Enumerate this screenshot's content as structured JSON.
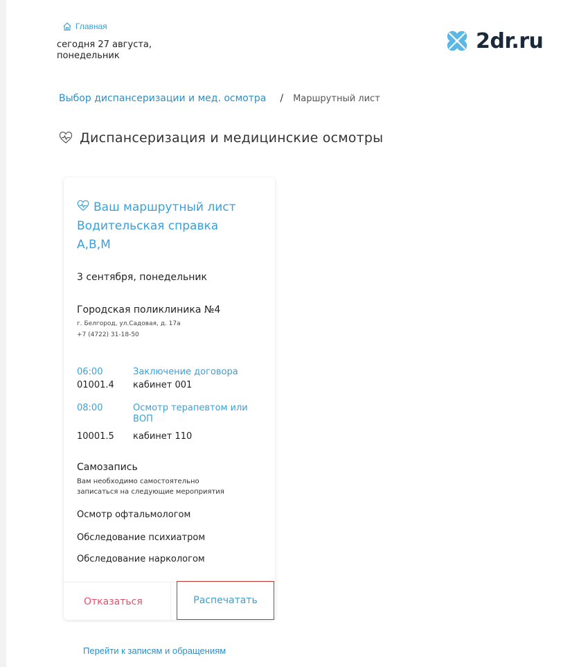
{
  "header": {
    "home_label": "Главная",
    "date_line1": "сегодня 27 августа,",
    "date_line2": "понедельник",
    "logo_text": "2dr.ru",
    "logo_color": "#5bb7e6"
  },
  "breadcrumb": {
    "link": "Выбор диспансеризации и мед. осмотра",
    "separator": "/",
    "current": "Маршрутный лист"
  },
  "page_title": "Диспансеризация и медицинские осмотры",
  "card": {
    "heading_line1": "Ваш маршрутный лист",
    "heading_line2": "Водительская справка",
    "heading_line3": "А,В,М",
    "date": "3 сентября, понедельник",
    "clinic_name": "Городская поликлиника №4",
    "clinic_address": "г. Белгород, ул.Садовая, д. 17а",
    "clinic_phone": "+7 (4722) 31-18-50",
    "appointments": [
      {
        "time": "06:00",
        "code": "01001.4",
        "name_line1": "Заключение договора",
        "name_line2": "",
        "room": "кабинет 001"
      },
      {
        "time": "08:00",
        "code": "10001.5",
        "name_line1": "Осмотр терапевтом или",
        "name_line2": "ВОП",
        "room": "кабинет 110"
      }
    ],
    "self_record_title": "Самозапись",
    "self_record_note_line1": "Вам необходимо самостоятельно",
    "self_record_note_line2": "записаться на следующие мероприятия",
    "self_record_items": [
      "Осмотр офтальмологом",
      "Обследование психиатром",
      "Обследование наркологом"
    ],
    "decline_label": "Отказаться",
    "print_label": "Распечатать"
  },
  "bottom_link": "Перейти к записям и обращениям",
  "colors": {
    "accent": "#3aa0d8",
    "link": "#2c8fc9",
    "decline": "#e0536b",
    "highlight_border": "#c9302c"
  }
}
